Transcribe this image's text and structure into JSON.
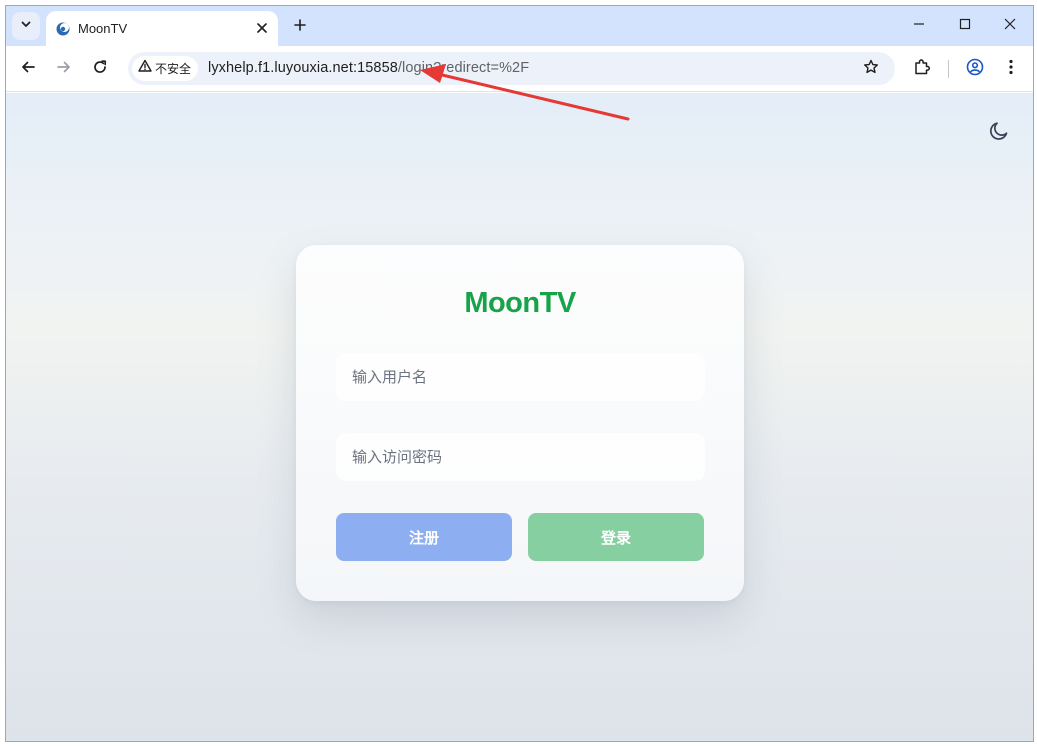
{
  "browser": {
    "tab": {
      "title": "MoonTV"
    },
    "address_bar": {
      "security_label": "不安全",
      "url_host": "lyxhelp.f1.luyouxia.net:15858",
      "url_path": "/login?redirect=%2F"
    },
    "icons": [
      "tab-search-icon",
      "favicon-icon",
      "close-icon",
      "plus-icon",
      "minimize-icon",
      "maximize-icon",
      "close-window-icon",
      "back-icon",
      "forward-icon",
      "reload-icon",
      "warning-icon",
      "star-icon",
      "extensions-icon",
      "profile-icon",
      "menu-icon"
    ]
  },
  "page": {
    "theme_toggle_icon": "moon-icon",
    "login_card": {
      "brand": "MoonTV",
      "username_placeholder": "输入用户名",
      "password_placeholder": "输入访问密码",
      "register_label": "注册",
      "login_label": "登录"
    }
  },
  "colors": {
    "brand": "#16a34a",
    "register_button": "#8eaef2",
    "login_button": "#86cfa0",
    "annotation_arrow": "#e53935"
  }
}
